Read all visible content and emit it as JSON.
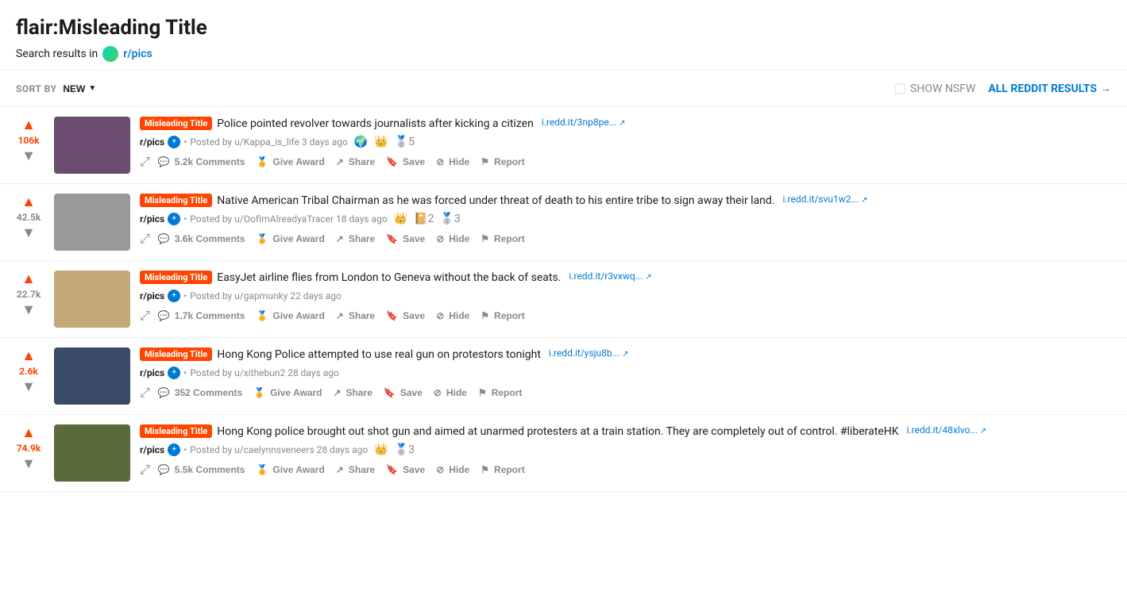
{
  "header": {
    "title": "flair:Misleading Title",
    "search_label": "Search results in",
    "subreddit": "r/pics"
  },
  "toolbar": {
    "sort_label": "SORT BY",
    "sort_value": "NEW",
    "nsfw_label": "SHOW NSFW",
    "all_reddit_label": "ALL REDDIT RESULTS",
    "all_reddit_arrow": "→"
  },
  "posts": [
    {
      "id": 1,
      "vote_count": "106k",
      "vote_colored": true,
      "flair": "Misleading Title",
      "title": "Police pointed revolver towards journalists after kicking a citizen",
      "domain": "i.redd.it/3np8pe...",
      "subreddit": "r/pics",
      "poster": "u/Kappa_is_life",
      "time_ago": "3 days ago",
      "awards": [
        {
          "type": "world",
          "emoji": "🌍"
        },
        {
          "type": "crown",
          "emoji": "👑"
        },
        {
          "type": "silver",
          "emoji": "🥈",
          "count": "5"
        }
      ],
      "comments": "5.2k Comments",
      "thumb_bg": "#6a4c6e",
      "action_row": [
        "Comments",
        "Give Award",
        "Share",
        "Save",
        "Hide",
        "Report"
      ]
    },
    {
      "id": 2,
      "vote_count": "42.5k",
      "vote_colored": false,
      "flair": "Misleading Title",
      "title": "Native American Tribal Chairman as he was forced under threat of death to his entire tribe to sign away their land.",
      "domain": "i.redd.it/svu1w2...",
      "subreddit": "r/pics",
      "poster": "u/OofImAlreadyaTracer",
      "time_ago": "18 days ago",
      "awards": [
        {
          "type": "crown",
          "emoji": "👑"
        },
        {
          "type": "book",
          "emoji": "📔",
          "count": "2"
        },
        {
          "type": "silver",
          "emoji": "🥈",
          "count": "3"
        }
      ],
      "comments": "3.6k Comments",
      "thumb_bg": "#bbb",
      "action_row": [
        "Comments",
        "Give Award",
        "Share",
        "Save",
        "Hide",
        "Report"
      ]
    },
    {
      "id": 3,
      "vote_count": "22.7k",
      "vote_colored": false,
      "flair": "Misleading Title",
      "title": "EasyJet airline flies from London to Geneva without the back of seats.",
      "domain": "i.redd.it/r3vxwq...",
      "subreddit": "r/pics",
      "poster": "u/gapmunky",
      "time_ago": "22 days ago",
      "awards": [],
      "comments": "1.7k Comments",
      "thumb_bg": "#d4a57a",
      "action_row": [
        "Comments",
        "Give Award",
        "Share",
        "Save",
        "Hide",
        "Report"
      ]
    },
    {
      "id": 4,
      "vote_count": "2.6k",
      "vote_colored": true,
      "flair": "Misleading Title",
      "title": "Hong Kong Police attempted to use real gun on protestors tonight",
      "domain": "i.redd.it/ysju8b...",
      "subreddit": "r/pics",
      "poster": "u/xithebun2",
      "time_ago": "28 days ago",
      "awards": [],
      "comments": "352 Comments",
      "thumb_bg": "#3a4a6a",
      "action_row": [
        "Comments",
        "Give Award",
        "Share",
        "Save",
        "Hide",
        "Report"
      ]
    },
    {
      "id": 5,
      "vote_count": "74.9k",
      "vote_colored": true,
      "flair": "Misleading Title",
      "title": "Hong Kong police brought out shot gun and aimed at unarmed protesters at a train station. They are completely out of control. #liberateHK",
      "domain": "i.redd.it/48xlvo...",
      "subreddit": "r/pics",
      "poster": "u/caelynnsveneers",
      "time_ago": "28 days ago",
      "awards": [
        {
          "type": "crown",
          "emoji": "👑"
        },
        {
          "type": "silver",
          "emoji": "🥈",
          "count": "3"
        }
      ],
      "comments": "5.5k Comments",
      "thumb_bg": "#5a6a3a",
      "action_row": [
        "Comments",
        "Give Award",
        "Share",
        "Save",
        "Hide",
        "Report"
      ]
    }
  ]
}
